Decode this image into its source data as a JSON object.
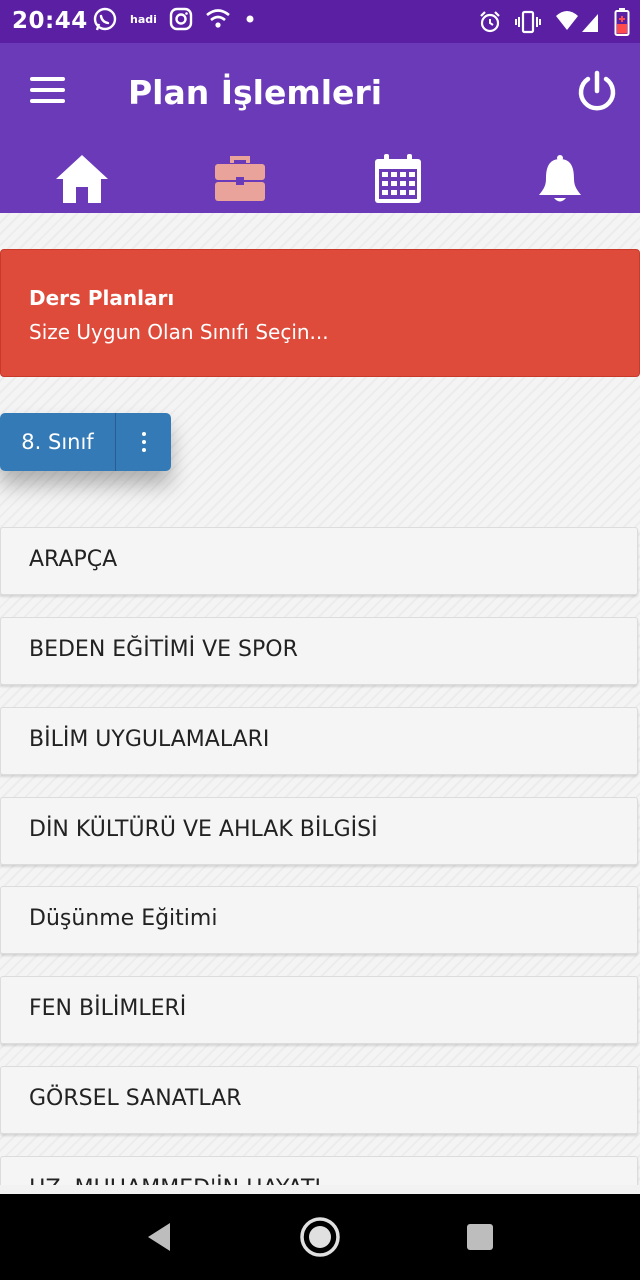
{
  "status_bar": {
    "time": "20:44",
    "carrier_text": "hadi",
    "icons": [
      "whatsapp-icon",
      "instagram-icon",
      "wifi-icon",
      "dot-icon",
      "alarm-icon",
      "vibrate-icon",
      "signal-icon",
      "battery-icon"
    ]
  },
  "app_bar": {
    "title": "Plan İşlemleri",
    "nav_icons": [
      "home-icon",
      "briefcase-icon",
      "calendar-icon",
      "bell-icon"
    ]
  },
  "alert": {
    "title": "Ders Planları",
    "text": "Size Uygun Olan Sınıfı Seçin..."
  },
  "class_selector": {
    "label": "8. Sınıf"
  },
  "subjects": [
    "ARAPÇA",
    "BEDEN EĞİTİMİ VE SPOR",
    "BİLİM UYGULAMALARI",
    "DİN KÜLTÜRÜ VE AHLAK BİLGİSİ",
    "Düşünme Eğitimi",
    "FEN BİLİMLERİ",
    "GÖRSEL SANATLAR",
    "HZ. MUHAMMED'İN HAYATI"
  ],
  "colors": {
    "status_bar": "#5b1fa3",
    "app_bar": "#6b3ab9",
    "alert": "#df4b3b",
    "button": "#337ab7",
    "briefcase": "#e9a39a"
  }
}
